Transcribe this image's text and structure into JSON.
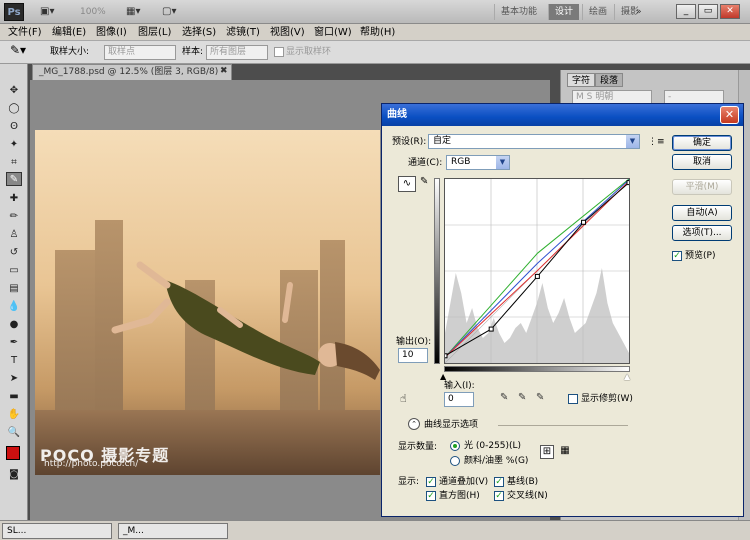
{
  "app": {
    "logo": "Ps",
    "zoom": "100%",
    "workspaces": [
      "基本功能",
      "设计",
      "绘画",
      "摄影"
    ],
    "active_workspace": "设计",
    "cs_label": "»"
  },
  "menu": [
    "文件(F)",
    "编辑(E)",
    "图像(I)",
    "图层(L)",
    "选择(S)",
    "滤镜(T)",
    "视图(V)",
    "窗口(W)",
    "帮助(H)"
  ],
  "options": {
    "sample_size_label": "取样大小:",
    "sample_size_value": "取样点",
    "sample_label": "样本:",
    "sample_value": "所有图层",
    "show_ring_label": "显示取样环"
  },
  "document": {
    "tab_title": "_MG_1788.psd @ 12.5% (图层 3, RGB/8) *",
    "watermark_brand": "POCO 摄影专题",
    "watermark_url": "http://photo.poco.cn/"
  },
  "right_panel": {
    "tabs": [
      "字符",
      "段落"
    ],
    "font_value": "M S 明朝",
    "font_style": "-"
  },
  "bottom": {
    "doc1": "SL...",
    "doc2": "_M..."
  },
  "curves": {
    "title": "曲线",
    "preset_label": "预设(R):",
    "preset_value": "自定",
    "channel_label": "通道(C):",
    "channel_value": "RGB",
    "output_label": "输出(O):",
    "output_value": "10",
    "input_label": "输入(I):",
    "input_value": "0",
    "show_clipping": "显示修剪(W)",
    "display_options": "曲线显示选项",
    "amount_label": "显示数量:",
    "light_label": "光 (0-255)(L)",
    "pigment_label": "颜料/油墨 %(G)",
    "show_label": "显示:",
    "channel_overlay": "通道叠加(V)",
    "baseline": "基线(B)",
    "histogram": "直方图(H)",
    "intersection": "交叉线(N)",
    "buttons": {
      "ok": "确定",
      "cancel": "取消",
      "smooth": "平滑(M)",
      "auto": "自动(A)",
      "options": "选项(T)...",
      "preview": "预览(P)"
    },
    "curve_colors": {
      "rgb": "#000000",
      "red": "#e03030",
      "green": "#30b030",
      "blue": "#3050d0"
    },
    "curve_points_rgb": [
      [
        0,
        10
      ],
      [
        64,
        47
      ],
      [
        128,
        120
      ],
      [
        192,
        195
      ],
      [
        255,
        250
      ]
    ],
    "curve_points_red": [
      [
        0,
        8
      ],
      [
        128,
        128
      ],
      [
        255,
        252
      ]
    ],
    "curve_points_green": [
      [
        0,
        8
      ],
      [
        128,
        152
      ],
      [
        255,
        255
      ]
    ],
    "curve_points_blue": [
      [
        0,
        8
      ],
      [
        128,
        138
      ],
      [
        255,
        254
      ]
    ]
  }
}
